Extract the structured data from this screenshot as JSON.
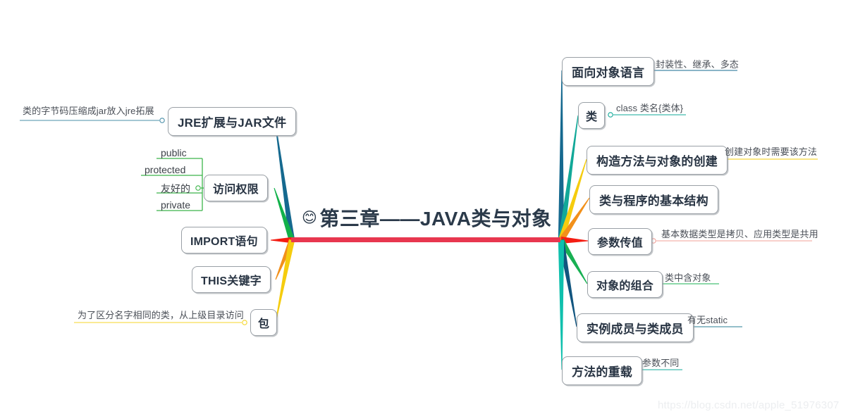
{
  "center": {
    "emoji": "😊",
    "title": "第三章——JAVA类与对象",
    "bar_color": "#e8374f"
  },
  "watermark": "https://blog.csdn.net/apple_51976307",
  "right_branches": [
    {
      "label": "面向对象语言",
      "color": "#15698f",
      "sublabel": "封装性、继承、多态",
      "sub_color": "#15698f"
    },
    {
      "label": "类",
      "color": "#11a898",
      "sublabel": "class 类名{类体}",
      "sub_color": "#11a898"
    },
    {
      "label": "构造方法与对象的创建",
      "color": "#f5cc0e",
      "sublabel": "创建对象时需要该方法",
      "sub_color": "#f5cc0e"
    },
    {
      "label": "类与程序的基本结构",
      "color": "#f2901a",
      "sublabel": "",
      "sub_color": "#f2901a"
    },
    {
      "label": "参数传值",
      "color": "#f41d13",
      "sublabel": "基本数据类型是拷贝、应用类型是共用",
      "sub_color": "#f0a099"
    },
    {
      "label": "对象的组合",
      "color": "#18b053",
      "sublabel": "类中含对象",
      "sub_color": "#18b053"
    },
    {
      "label": "实例成员与类成员",
      "color": "#11557f",
      "sublabel": "有无static",
      "sub_color": "#2a7f96"
    },
    {
      "label": "方法的重载",
      "color": "#0fc0ad",
      "sublabel": "参数不同",
      "sub_color": "#11a898"
    }
  ],
  "left_branches": [
    {
      "label": "JRE扩展与JAR文件",
      "color": "#15698f",
      "sublabel": "类的字节码压缩成jar放入jre拓展",
      "sub_color": "#4a8fa8"
    },
    {
      "label": "访问权限",
      "color": "#12b14a",
      "sublabel": "",
      "sub_color": "#3cb54a",
      "children": [
        "public",
        "protected",
        "友好的",
        "private"
      ]
    },
    {
      "label": "IMPORT语句",
      "color": "#f41d13",
      "sublabel": "",
      "sub_color": "#f41d13"
    },
    {
      "label": "THIS关键字",
      "color": "#f2901a",
      "sublabel": "",
      "sub_color": "#f2901a"
    },
    {
      "label": "包",
      "color": "#f5cc0e",
      "sublabel": "为了区分名字相同的类，从上级目录访问",
      "sub_color": "#f5d52a"
    }
  ]
}
